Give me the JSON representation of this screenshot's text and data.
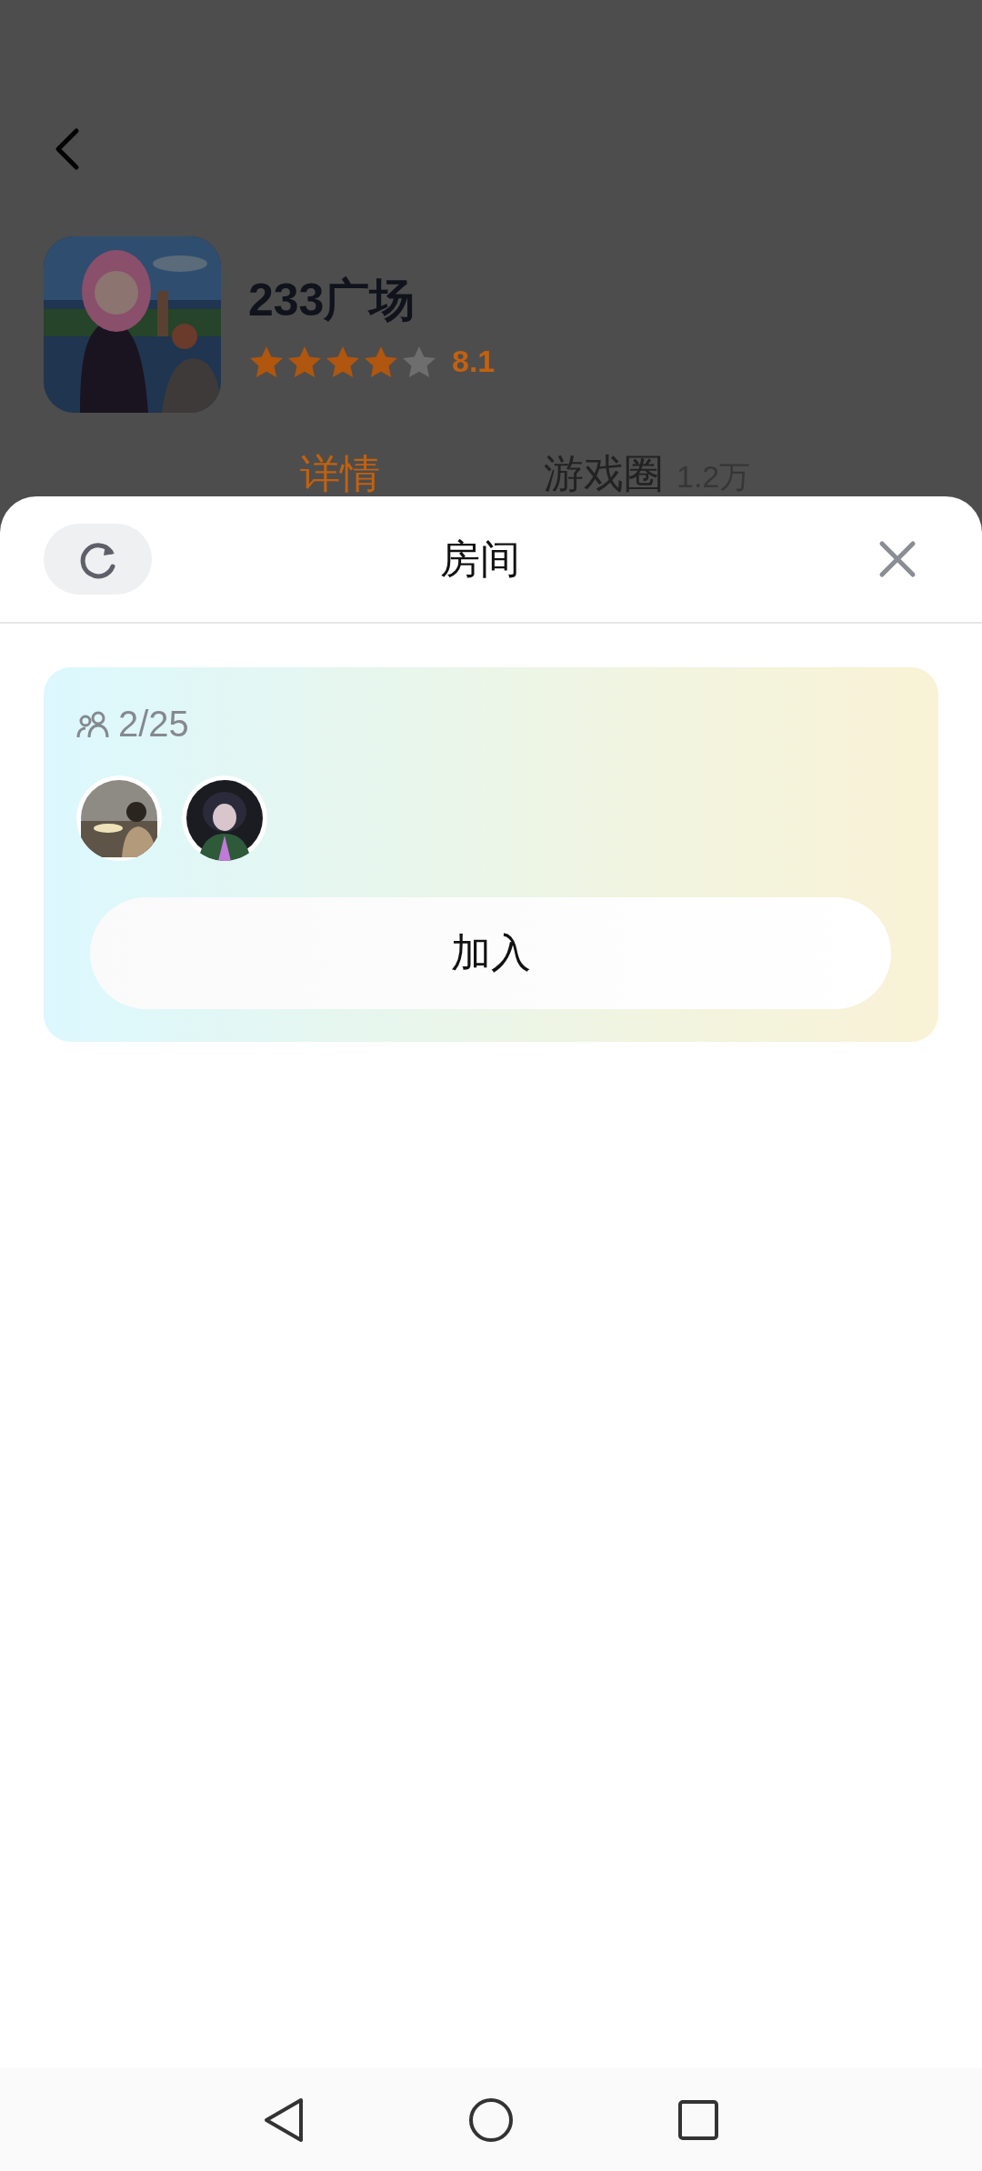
{
  "app": {
    "title": "233广场",
    "stars": 4,
    "rating": "8.1"
  },
  "tabs": [
    {
      "label": "详情",
      "selected": true
    },
    {
      "label": "游戏圈",
      "count": "1.2万",
      "selected": false
    }
  ],
  "sheet": {
    "title": "房间"
  },
  "rooms": [
    {
      "members": "2/25",
      "button": "加入"
    }
  ]
}
